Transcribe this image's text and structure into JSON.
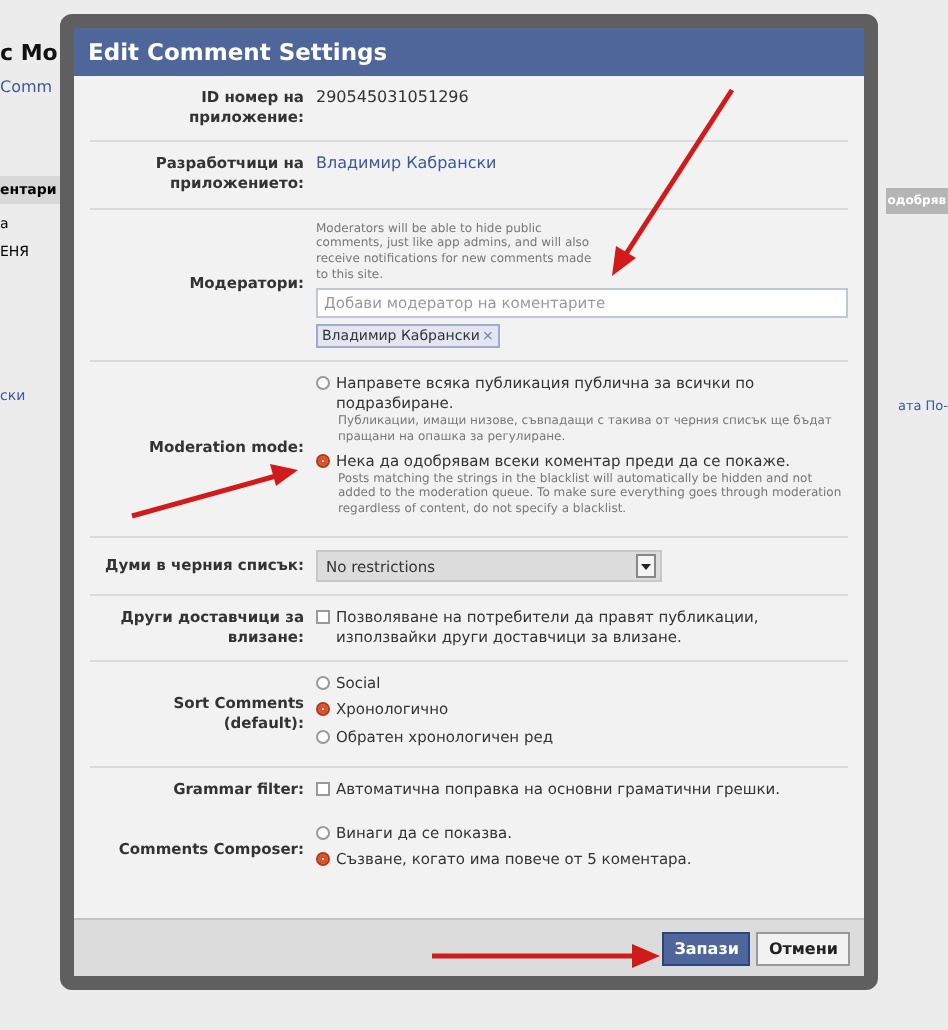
{
  "background_page": {
    "title": "c Mo",
    "link": "Comm",
    "left_items": [
      {
        "text": "ентари",
        "kind": "band"
      },
      {
        "text": "а",
        "kind": "plain"
      },
      {
        "text": "ЕНЯ",
        "kind": "plain"
      },
      {
        "text": "ски",
        "kind": "link"
      }
    ],
    "right_items": [
      {
        "text": "одобряв",
        "kind": "button"
      },
      {
        "text": "ата По-",
        "kind": "link"
      }
    ]
  },
  "dialog": {
    "title": "Edit Comment Settings",
    "fields": [
      {
        "kind": "text",
        "label": "ID номер на приложение:",
        "value": "290545031051296"
      },
      {
        "kind": "link",
        "label": "Разработчици на приложението:",
        "value": "Владимир Кабрански"
      },
      {
        "kind": "moderators",
        "label": "Модератори:",
        "hint": "Moderators will be able to hide public comments, just like app admins, and will also receive notifications for new comments made to this site.",
        "placeholder": "Добави модератор на коментарите",
        "tokens": [
          {
            "text": "Владимир Кабрански",
            "remove": "×"
          }
        ]
      },
      {
        "kind": "radios",
        "label": "Moderation mode:",
        "options": [
          {
            "label": "Направете всяка публикация публична за всички по подразбиране.",
            "hint": "Публикации, имащи низове, съвпадащи с такива от черния списък ще бъдат пращани на опашка за регулиране.",
            "selected": false
          },
          {
            "label": "Нека да одобрявам всеки коментар преди да се покаже.",
            "hint": "Posts matching the strings in the blacklist will automatically be hidden and not added to the moderation queue. To make sure everything goes through moderation regardless of content, do not specify a blacklist.",
            "selected": true
          }
        ]
      },
      {
        "kind": "select",
        "label": "Думи в черния списък:",
        "value": "No restrictions"
      },
      {
        "kind": "checkbox",
        "label": "Други доставчици за влизане:",
        "text": "Позволяване на потребители да правят публикации, използвайки други доставчици за влизане.",
        "checked": false
      },
      {
        "kind": "radios",
        "label": "Sort Comments (default):",
        "options": [
          {
            "label": "Social",
            "selected": false
          },
          {
            "label": "Хронологично",
            "selected": true
          },
          {
            "label": "Обратен хронологичен ред",
            "selected": false
          }
        ]
      },
      {
        "kind": "checkbox",
        "label": "Grammar filter:",
        "text": "Автоматична поправка на основни граматични грешки.",
        "checked": false
      },
      {
        "kind": "radios",
        "label": "Comments Composer:",
        "options": [
          {
            "label": "Винаги да се показва.",
            "selected": false
          },
          {
            "label": "Съзване, когато има повече от 5 коментара.",
            "selected": true
          }
        ]
      }
    ],
    "buttons": [
      {
        "label": "Запази",
        "kind": "primary"
      },
      {
        "label": "Отмени",
        "kind": "secondary"
      }
    ]
  }
}
